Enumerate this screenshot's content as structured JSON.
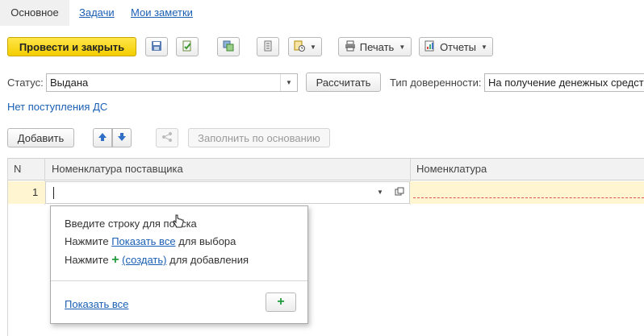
{
  "tabs": [
    "Основное",
    "Задачи",
    "Мои заметки"
  ],
  "toolbar": {
    "post_close_label": "Провести и закрыть",
    "print_label": "Печать",
    "reports_label": "Отчеты",
    "icons": [
      "save-icon",
      "post-icon",
      "structure-icon",
      "list-icon",
      "doc-clock-icon",
      "printer-icon",
      "report-icon"
    ]
  },
  "status": {
    "label": "Статус:",
    "value": "Выдана",
    "calc_label": "Рассчитать",
    "trust_label": "Тип доверенности:",
    "trust_value": "На получение денежных средст"
  },
  "no_receipts_link": "Нет поступления ДС",
  "table_toolbar": {
    "add_label": "Добавить",
    "fill_label": "Заполнить по основанию"
  },
  "table": {
    "columns": [
      "N",
      "Номенклатура поставщика",
      "Номенклатура"
    ],
    "rows": [
      {
        "n": "1",
        "supplier_item": "",
        "item": ""
      }
    ]
  },
  "popup": {
    "line1": "Введите строку для поиска",
    "line2_pre": "Нажмите",
    "line2_link": "Показать все",
    "line2_post": "для выбора",
    "line3_pre": "Нажмите",
    "line3_link": "(создать)",
    "line3_post": "для добавления",
    "show_all": "Показать все"
  },
  "colors": {
    "primary": "#f3cd00",
    "link": "#1a5fb4",
    "row_highlight": "#fff5d1",
    "add_plus": "#1f9a3c"
  }
}
